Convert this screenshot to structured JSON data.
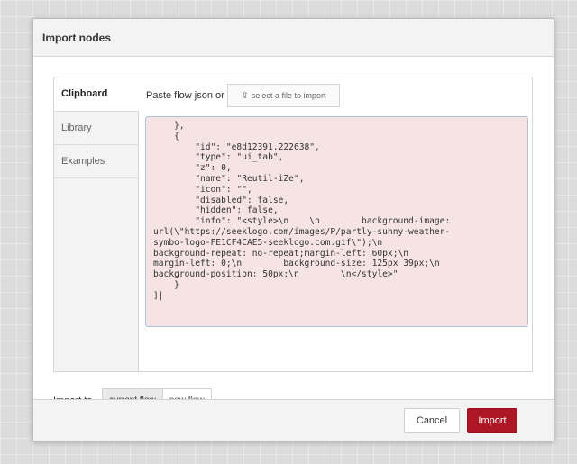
{
  "dialog": {
    "title": "Import nodes"
  },
  "tabs": [
    {
      "label": "Clipboard",
      "active": true
    },
    {
      "label": "Library",
      "active": false
    },
    {
      "label": "Examples",
      "active": false
    }
  ],
  "clipboard": {
    "paste_label": "Paste flow json or",
    "file_button_label": "select a file to import",
    "file_button_icon": "upload-icon",
    "editor_text": "    },\n    {\n        \"id\": \"e8d12391.222638\",\n        \"type\": \"ui_tab\",\n        \"z\": 0,\n        \"name\": \"Reutil-iZe\",\n        \"icon\": \"\",\n        \"disabled\": false,\n        \"hidden\": false,\n        \"info\": \"<style>\\n    \\n        background-image:\nurl(\\\"https://seeklogo.com/images/P/partly-sunny-weather-\nsymbo-logo-FE1CF4CAE5-seeklogo.com.gif\\\");\\n\nbackground-repeat: no-repeat;margin-left: 60px;\\n\nmargin-left: 0;\\n        background-size: 125px 39px;\\n\nbackground-position: 50px;\\n        \\n</style>\"\n    }\n]|"
  },
  "import_to": {
    "label": "Import to",
    "options": [
      {
        "label": "current flow",
        "selected": true
      },
      {
        "label": "new flow",
        "selected": false
      }
    ]
  },
  "footer": {
    "cancel_label": "Cancel",
    "import_label": "Import"
  },
  "colors": {
    "import_button": "#ad1625",
    "editor_background": "#f6e4e5",
    "editor_border": "#a7c3df"
  }
}
